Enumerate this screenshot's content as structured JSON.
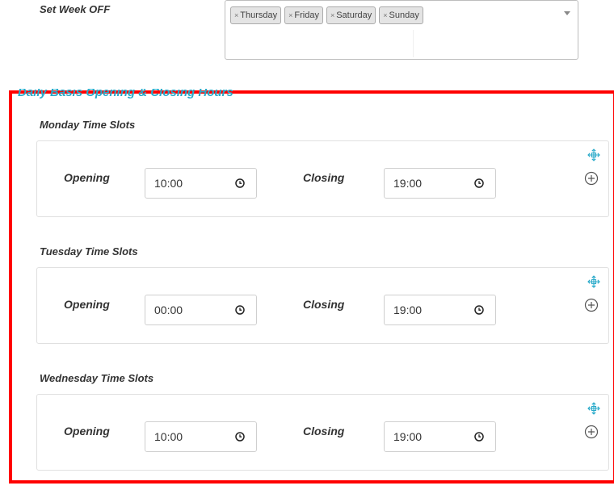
{
  "week_off": {
    "label": "Set Week OFF",
    "selected": [
      {
        "label": "Thursday"
      },
      {
        "label": "Friday"
      },
      {
        "label": "Saturday"
      },
      {
        "label": "Sunday"
      }
    ],
    "remove_symbol": "×"
  },
  "section": {
    "title": "Daily Basis Opening & Closing Hours",
    "border_color": "#ff0000",
    "title_color": "#27a9c9"
  },
  "days": [
    {
      "label": "Monday Time Slots",
      "opening_label": "Opening",
      "opening_value": "10:00",
      "closing_label": "Closing",
      "closing_value": "19:00"
    },
    {
      "label": "Tuesday Time Slots",
      "opening_label": "Opening",
      "opening_value": "00:00",
      "closing_label": "Closing",
      "closing_value": "19:00"
    },
    {
      "label": "Wednesday Time Slots",
      "opening_label": "Opening",
      "opening_value": "10:00",
      "closing_label": "Closing",
      "closing_value": "19:00"
    }
  ],
  "icons": {
    "move": "move-arrows-icon",
    "add": "plus-circle-icon",
    "clock": "clock-icon",
    "dropdown": "chevron-down-icon"
  }
}
